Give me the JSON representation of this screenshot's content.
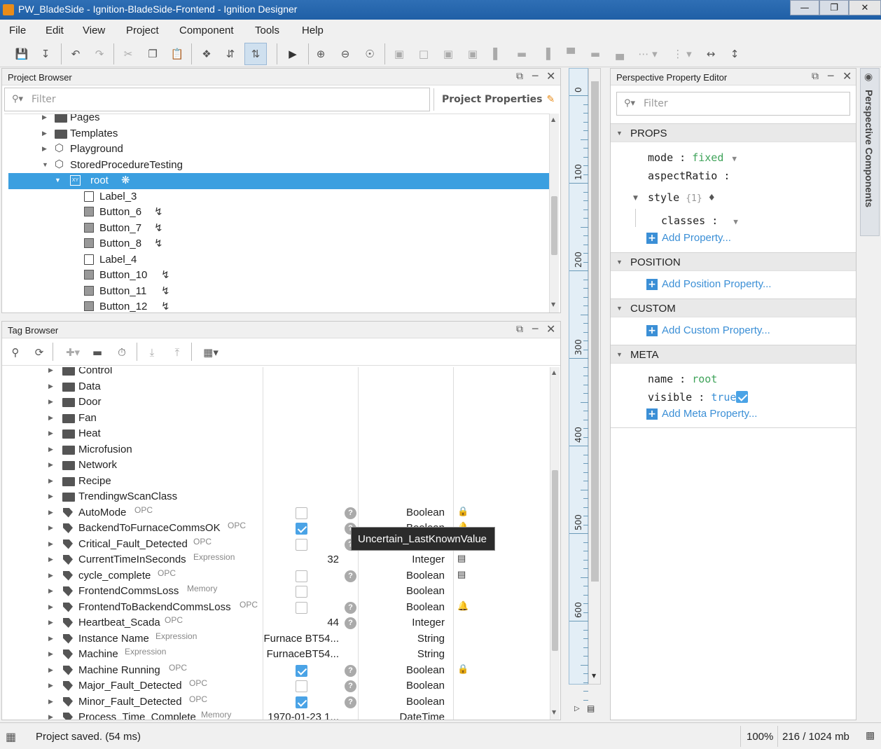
{
  "window": {
    "title": "PW_BladeSide - Ignition-BladeSide-Frontend - Ignition Designer"
  },
  "menu": [
    "File",
    "Edit",
    "View",
    "Project",
    "Component",
    "Tools",
    "Help"
  ],
  "project_browser": {
    "title": "Project Browser",
    "filter_placeholder": "Filter",
    "project_properties": "Project Properties",
    "items": [
      {
        "label": "Pages",
        "depth": 1,
        "icon": "folder-icon"
      },
      {
        "label": "Templates",
        "depth": 1,
        "icon": "folder-icon"
      },
      {
        "label": "Playground",
        "depth": 1,
        "icon": "cube-icon"
      },
      {
        "label": "StoredProcedureTesting",
        "depth": 1,
        "icon": "cube-icon"
      },
      {
        "label": "root",
        "depth": 2,
        "icon": "xy-container-icon",
        "selected": true
      },
      {
        "label": "Label_3",
        "depth": 3,
        "icon": "label-icon"
      },
      {
        "label": "Button_6",
        "depth": 3,
        "icon": "button-icon",
        "event": true
      },
      {
        "label": "Button_7",
        "depth": 3,
        "icon": "button-icon",
        "event": true
      },
      {
        "label": "Button_8",
        "depth": 3,
        "icon": "button-icon",
        "event": true
      },
      {
        "label": "Label_4",
        "depth": 3,
        "icon": "label-icon"
      },
      {
        "label": "Button_10",
        "depth": 3,
        "icon": "button-icon",
        "event": true
      },
      {
        "label": "Button_11",
        "depth": 3,
        "icon": "button-icon",
        "event": true
      },
      {
        "label": "Button_12",
        "depth": 3,
        "icon": "button-icon",
        "event": true
      }
    ]
  },
  "tag_browser": {
    "title": "Tag Browser",
    "folders": [
      "Control",
      "Data",
      "Door",
      "Fan",
      "Heat",
      "Microfusion",
      "Network",
      "Recipe",
      "TrendingwScanClass"
    ],
    "tags": [
      {
        "name": "AutoMode",
        "kind": "OPC",
        "value": "",
        "check": "off",
        "q": true,
        "type": "Boolean",
        "icon": "lock"
      },
      {
        "name": "BackendToFurnaceCommsOK",
        "kind": "OPC",
        "value": "",
        "check": "on",
        "q": true,
        "type": "Boolean",
        "icon": "bell"
      },
      {
        "name": "Critical_Fault_Detected",
        "kind": "OPC",
        "value": "",
        "check": "off",
        "q": true,
        "type": "",
        "icon": ""
      },
      {
        "name": "CurrentTimeInSeconds",
        "kind": "Expression",
        "value": "32",
        "check": "",
        "q": false,
        "type": "Integer",
        "icon": "script"
      },
      {
        "name": "cycle_complete",
        "kind": "OPC",
        "value": "",
        "check": "off",
        "q": true,
        "type": "Boolean",
        "icon": "script"
      },
      {
        "name": "FrontendCommsLoss",
        "kind": "Memory",
        "value": "",
        "check": "off",
        "q": false,
        "type": "Boolean",
        "icon": ""
      },
      {
        "name": "FrontendToBackendCommsLoss",
        "kind": "OPC",
        "value": "",
        "check": "off",
        "q": true,
        "type": "Boolean",
        "icon": "bell"
      },
      {
        "name": "Heartbeat_Scada",
        "kind": "OPC",
        "value": "44",
        "check": "",
        "q": true,
        "type": "Integer",
        "icon": ""
      },
      {
        "name": "Instance Name",
        "kind": "Expression",
        "value": "Furnace BT54...",
        "check": "",
        "q": false,
        "type": "String",
        "icon": ""
      },
      {
        "name": "Machine",
        "kind": "Expression",
        "value": "FurnaceBT54...",
        "check": "",
        "q": false,
        "type": "String",
        "icon": ""
      },
      {
        "name": "Machine Running",
        "kind": "OPC",
        "value": "",
        "check": "on",
        "q": true,
        "type": "Boolean",
        "icon": "lock"
      },
      {
        "name": "Major_Fault_Detected",
        "kind": "OPC",
        "value": "",
        "check": "off",
        "q": true,
        "type": "Boolean",
        "icon": ""
      },
      {
        "name": "Minor_Fault_Detected",
        "kind": "OPC",
        "value": "",
        "check": "on",
        "q": true,
        "type": "Boolean",
        "icon": ""
      },
      {
        "name": "Process_Time_Complete",
        "kind": "Memory",
        "value": "1970-01-23 1...",
        "check": "",
        "q": false,
        "type": "DateTime",
        "icon": ""
      }
    ],
    "tooltip": "Uncertain_LastKnownValue",
    "partial_type": "Boolean"
  },
  "ruler": {
    "labels": [
      "0",
      "100",
      "200",
      "300",
      "400",
      "500",
      "600"
    ]
  },
  "property_editor": {
    "title": "Perspective Property Editor",
    "filter_placeholder": "Filter",
    "props": {
      "section": "PROPS",
      "mode_key": "mode",
      "mode_val": "fixed",
      "aspect_key": "aspectRatio",
      "style_key": "style",
      "style_count": "{1}",
      "classes_key": "classes",
      "add": "Add Property..."
    },
    "position": {
      "section": "POSITION",
      "add": "Add Position Property..."
    },
    "custom": {
      "section": "CUSTOM",
      "add": "Add Custom Property..."
    },
    "meta": {
      "section": "META",
      "name_key": "name",
      "name_val": "root",
      "visible_key": "visible",
      "visible_val": "true",
      "add": "Add Meta Property..."
    }
  },
  "side_tab": "Perspective Components",
  "status": {
    "message": "Project saved. (54 ms)",
    "zoom": "100%",
    "memory": "216 / 1024 mb"
  },
  "colors": {
    "accent": "#3b9fe0",
    "link": "#3b8fd6",
    "titlebar": "#2f6fb5"
  }
}
